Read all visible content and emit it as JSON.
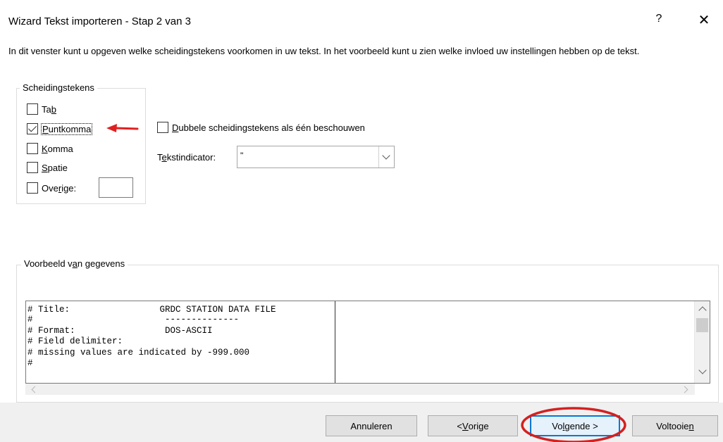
{
  "window": {
    "title": "Wizard Tekst importeren - Stap 2 van 3",
    "help_label": "?",
    "close_label": "✕"
  },
  "description": "In dit venster kunt u opgeven welke scheidingstekens voorkomen in uw tekst. In het voorbeeld kunt u zien welke invloed uw instellingen hebben op de tekst.",
  "delimiters": {
    "legend": "Scheidingstekens",
    "tab": {
      "pre": "Ta",
      "key": "b",
      "post": "",
      "checked": false
    },
    "semicolon": {
      "pre": "",
      "key": "P",
      "post": "untkomma",
      "checked": true
    },
    "comma": {
      "pre": "",
      "key": "K",
      "post": "omma",
      "checked": false
    },
    "space": {
      "pre": "",
      "key": "S",
      "post": "patie",
      "checked": false
    },
    "other": {
      "pre": "Ove",
      "key": "r",
      "post": "ige:",
      "checked": false,
      "value": ""
    }
  },
  "options": {
    "consecutive": {
      "pre": "",
      "key": "D",
      "post": "ubbele scheidingstekens als één beschouwen",
      "checked": false
    },
    "text_qualifier": {
      "pre": "T",
      "key": "e",
      "post": "kstindicator:",
      "value": "\""
    }
  },
  "preview": {
    "legend_pre": "Voorbeeld v",
    "legend_key": "a",
    "legend_post": "n gegevens",
    "lines": [
      "# Title:                 GRDC STATION DATA FILE",
      "#                         --------------",
      "# Format:                 DOS-ASCII",
      "# Field delimiter:",
      "# missing values are indicated by -999.000",
      "#"
    ]
  },
  "buttons": {
    "cancel": "Annuleren",
    "back": {
      "pre": "< ",
      "key": "V",
      "post": "orige"
    },
    "next": {
      "pre": "Vo",
      "key": "l",
      "post": "gende >"
    },
    "finish": {
      "pre": "Voltooie",
      "key": "n",
      "post": ""
    }
  },
  "annotations": {
    "arrow_color": "#e02020",
    "circle_color": "#d42020"
  }
}
